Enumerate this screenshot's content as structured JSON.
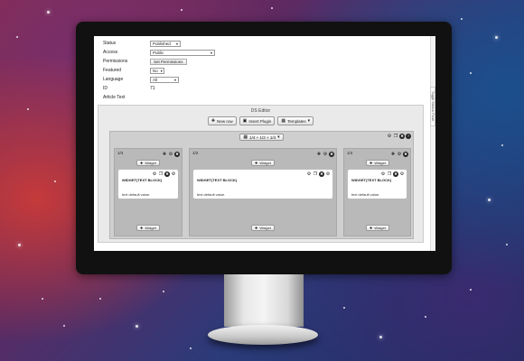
{
  "form": {
    "status_label": "Status",
    "status_value": "Published",
    "access_label": "Access",
    "access_value": "Public",
    "permissions_label": "Permissions",
    "permissions_button": "Set Permissions",
    "featured_label": "Featured",
    "featured_value": "No",
    "language_label": "Language",
    "language_value": "All",
    "id_label": "ID",
    "id_value": "71",
    "article_text_label": "Article Text"
  },
  "editor": {
    "title": "DS Editor",
    "new_row": "New row",
    "insert_plugin": "Insert Plugin",
    "templates": "Templates",
    "layout_select": "1/4 + 1/2 + 1/4",
    "side_tab": "Toggle Sidebar Panel"
  },
  "columns": [
    {
      "label": "1/4",
      "add_widget": "Widget",
      "widget_title": "WIDGET(TEXT BLOCK)",
      "widget_text": "text default value."
    },
    {
      "label": "1/2",
      "add_widget": "Widget",
      "widget_title": "WIDGET(TEXT BLOCK)",
      "widget_text": "text default value."
    },
    {
      "label": "1/4",
      "add_widget": "Widget",
      "widget_title": "WIDGET(TEXT BLOCK)",
      "widget_text": "text default value."
    }
  ]
}
